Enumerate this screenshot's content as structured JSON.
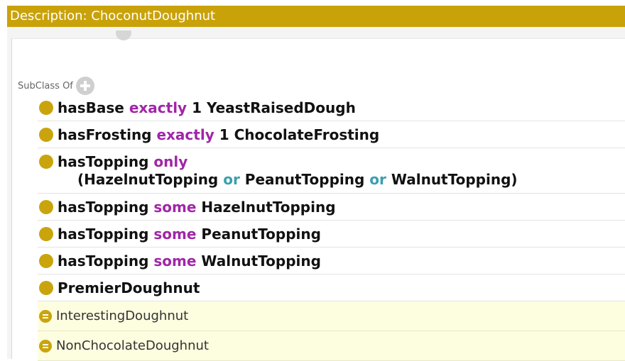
{
  "window": {
    "title": "Description: ChoconutDoughnut"
  },
  "section": {
    "title": "SubClass Of"
  },
  "superclasses": [
    {
      "property": "hasBase",
      "restriction": "exactly",
      "cardinality": "1",
      "filler": "YeastRaisedDough"
    },
    {
      "property": "hasFrosting",
      "restriction": "exactly",
      "cardinality": "1",
      "filler": "ChocolateFrosting"
    },
    {
      "property": "hasTopping",
      "restriction": "only",
      "union": {
        "open": "(",
        "a": "HazelnutTopping",
        "op1": "or",
        "b": "PeanutTopping",
        "op2": "or",
        "c": "WalnutTopping",
        "close": ")"
      }
    },
    {
      "property": "hasTopping",
      "restriction": "some",
      "filler": "HazelnutTopping"
    },
    {
      "property": "hasTopping",
      "restriction": "some",
      "filler": "PeanutTopping"
    },
    {
      "property": "hasTopping",
      "restriction": "some",
      "filler": "WalnutTopping"
    },
    {
      "filler": "PremierDoughnut"
    }
  ],
  "inferred": [
    {
      "label": "InterestingDoughnut"
    },
    {
      "label": "NonChocolateDoughnut"
    }
  ],
  "colors": {
    "header_bg": "#c9a20a",
    "keyword": "#a026a8",
    "union_or": "#3a9fb0",
    "class_dot": "#c9a40d",
    "inferred_bg": "#fdfde0"
  },
  "icons": {
    "add": "plus-circle-icon",
    "asserted": "class-dot-icon",
    "inferred": "inferred-class-icon"
  }
}
